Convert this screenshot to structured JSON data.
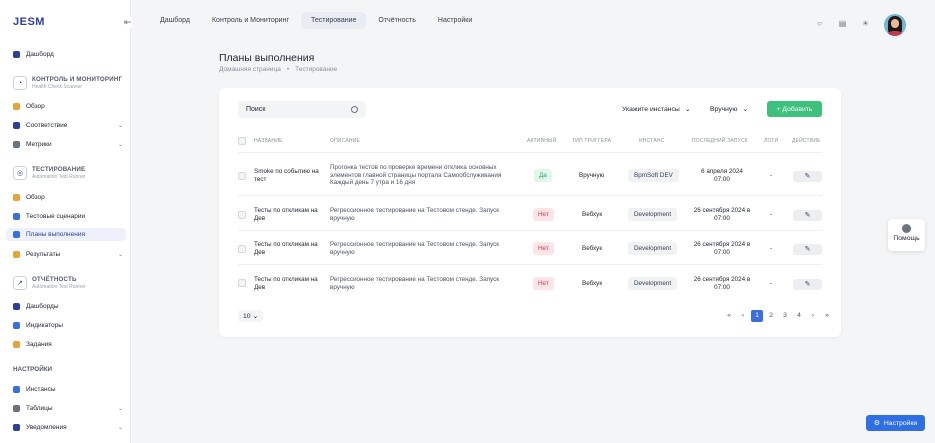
{
  "app": {
    "logo": "JESM"
  },
  "sidebar": {
    "dashboard": "Дашборд",
    "group1": {
      "title": "КОНТРОЛЬ И МОНИТОРИНГ",
      "subtitle": "Health Check Scanner"
    },
    "g1items": [
      "Обзор",
      "Соответствие",
      "Метрики"
    ],
    "group2": {
      "title": "ТЕСТИРОВАНИЕ",
      "subtitle": "Automation Test Runner"
    },
    "g2items": [
      "Обзор",
      "Тестовые сценарии",
      "Планы выполнения",
      "Результаты"
    ],
    "group3": {
      "title": "ОТЧЁТНОСТЬ",
      "subtitle": "Automation Test Runner"
    },
    "g3items": [
      "Дашборды",
      "Индикаторы",
      "Задания"
    ],
    "settings_head": "НАСТРОЙКИ",
    "g4items": [
      "Инстансы",
      "Таблицы",
      "Уведомления"
    ]
  },
  "topnav": {
    "tabs": [
      "Дашборд",
      "Контроль и Мониторинг",
      "Тестирование",
      "Отчётность",
      "Настройки"
    ],
    "active": "Тестирование"
  },
  "page": {
    "title": "Планы выполнения",
    "crumbs": [
      "Домашняя страница",
      "•",
      "Тестирование"
    ]
  },
  "toolbar": {
    "search": "Поиск",
    "instance": "Укажите инстансы",
    "trigger": "Вручную",
    "add": "+ Добавить"
  },
  "table": {
    "headers": [
      "НАЗВАНИЕ",
      "ОПИСАНИЕ",
      "АКТИВНЫЙ",
      "ТИП ТРИГГЕРА",
      "ИНСТАНС",
      "ПОСЛЕДНИЙ ЗАПУСК",
      "ЛОГИ",
      "ДЕЙСТВИЕ"
    ],
    "rows": [
      {
        "name": "Smoke по событию на тест",
        "desc": "Прогонка тестов по проверке времени отклика основных элементов главной страницы портала Самообслуживания Каждый день 7 утра и 16 дня",
        "active": "Да",
        "trigger": "Вручную",
        "instance": "BpmSoft DEV",
        "last": "6 апреля 2024 07:00",
        "logs": "-"
      },
      {
        "name": "Тесты по откликам на Дев",
        "desc": "Регрессионное тестирование на Тестовом стенде. Запуск вручную",
        "active": "Нет",
        "trigger": "Вебхук",
        "instance": "Development",
        "last": "26 сентября 2024 в 07:00",
        "logs": "-"
      },
      {
        "name": "Тесты по откликам на Дев",
        "desc": "Регрессионное тестирование на Тестовом стенде. Запуск вручную",
        "active": "Нет",
        "trigger": "Вебхук",
        "instance": "Development",
        "last": "26 сентября 2024 в 07:00",
        "logs": "-"
      },
      {
        "name": "Тесты по откликам на Дев",
        "desc": "Регрессионное тестирование на Тестовом стенде. Запуск вручную",
        "active": "Нет",
        "trigger": "Вебхук",
        "instance": "Development",
        "last": "26 сентября 2024 в 07:00",
        "logs": "-"
      }
    ]
  },
  "pagination": {
    "per_page": "10",
    "pages": [
      "1",
      "2",
      "3",
      "4"
    ],
    "current": "1"
  },
  "help": "Помощь",
  "settings_button": "Настройки"
}
